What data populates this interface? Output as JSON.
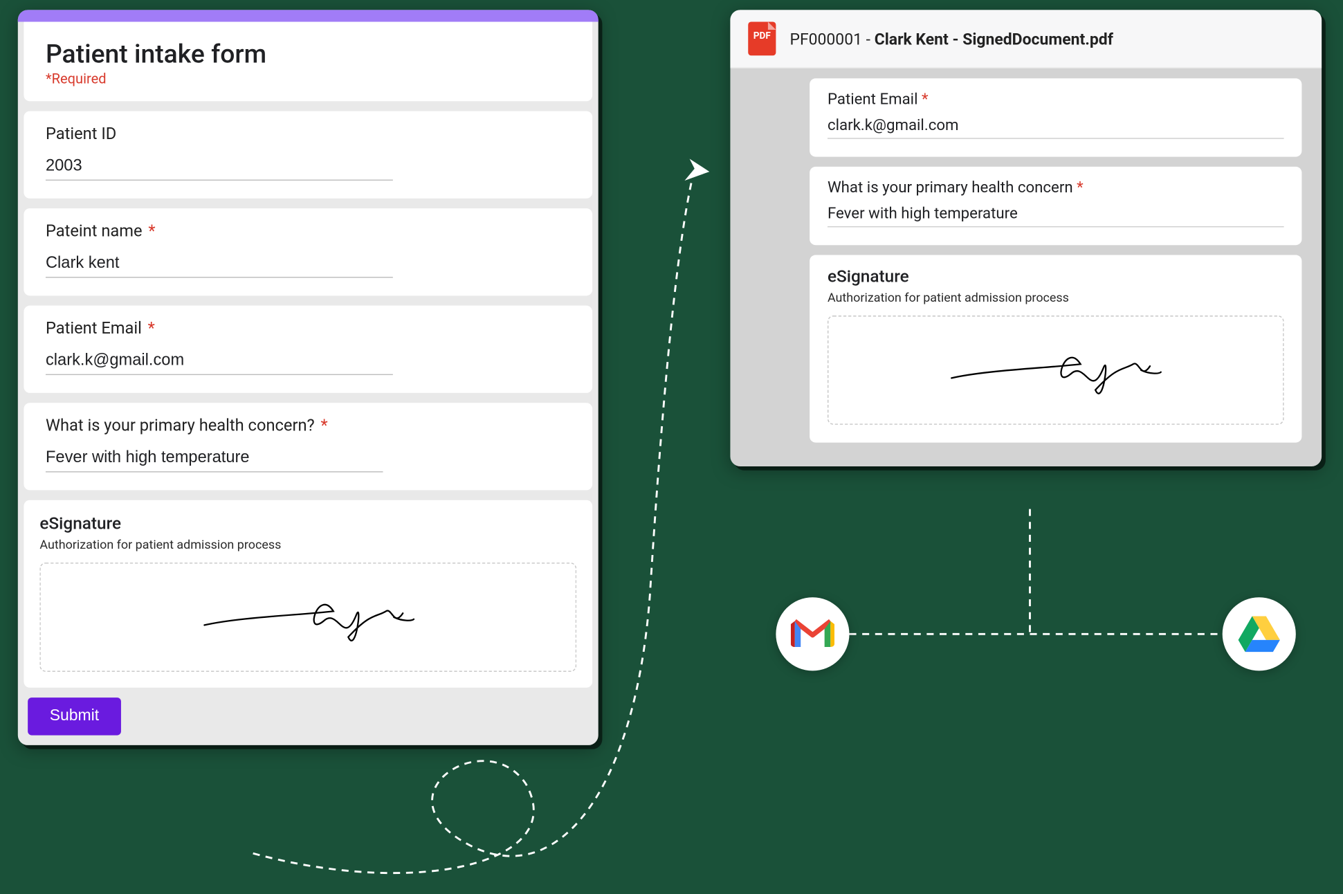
{
  "form": {
    "title": "Patient intake form",
    "required_note": "*Required",
    "fields": {
      "patient_id": {
        "label": "Patient ID",
        "value": "2003"
      },
      "patient_name": {
        "label": "Pateint name",
        "value": "Clark kent",
        "required": true
      },
      "patient_email": {
        "label": "Patient Email",
        "value": "clark.k@gmail.com",
        "required": true
      },
      "concern": {
        "label": "What is your primary health concern?",
        "value": "Fever with high temperature",
        "required": true
      }
    },
    "signature": {
      "title": "eSignature",
      "subtitle": "Authorization for patient admission process"
    },
    "submit_label": "Submit"
  },
  "pdf": {
    "icon_label": "PDF",
    "filename_prefix": "PF000001 - ",
    "filename_bold": "Clark Kent - SignedDocument.pdf",
    "email": {
      "label": "Patient Email",
      "value": "clark.k@gmail.com",
      "required": true
    },
    "concern": {
      "label": "What is your primary health concern",
      "value": "Fever with high temperature",
      "required": true
    },
    "signature": {
      "title": "eSignature",
      "subtitle": "Authorization for patient admission process"
    }
  },
  "asterisk": "*",
  "services": {
    "gmail": "Gmail",
    "drive": "Google Drive"
  }
}
